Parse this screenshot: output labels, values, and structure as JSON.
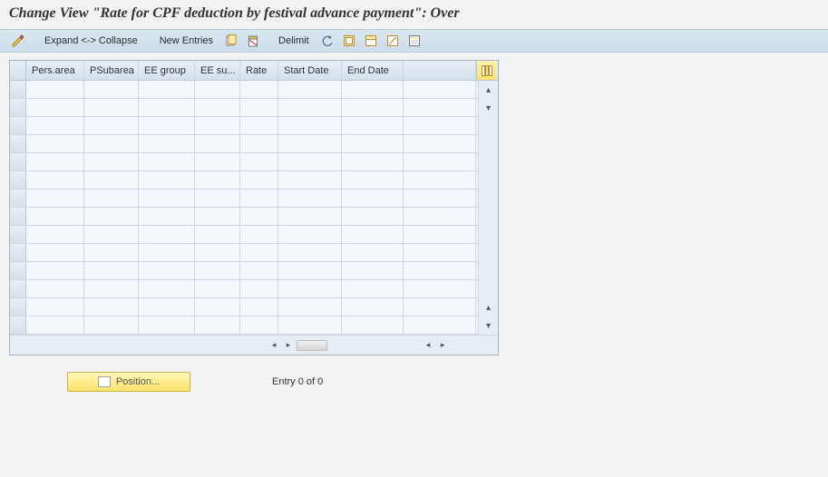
{
  "title": "Change View \"Rate for CPF deduction by festival advance payment\": Over",
  "toolbar": {
    "expand_collapse": "Expand <-> Collapse",
    "new_entries": "New Entries",
    "delimit": "Delimit"
  },
  "columns": {
    "pers_area": "Pers.area",
    "psubarea": "PSubarea",
    "ee_group": "EE group",
    "ee_su": "EE su...",
    "rate": "Rate",
    "start_date": "Start Date",
    "end_date": "End Date"
  },
  "rows": [
    {},
    {},
    {},
    {},
    {},
    {},
    {},
    {},
    {},
    {},
    {},
    {},
    {},
    {}
  ],
  "footer": {
    "position_label": "Position...",
    "entry_text": "Entry 0 of 0"
  }
}
